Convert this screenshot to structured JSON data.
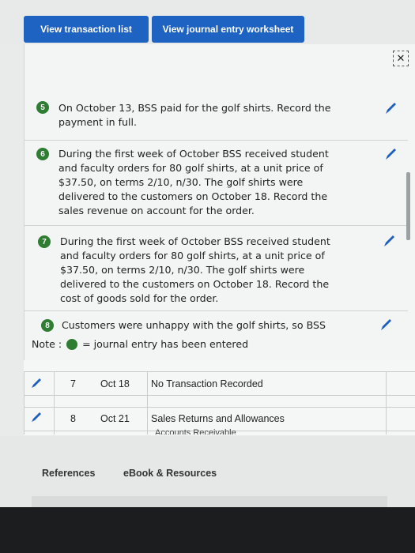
{
  "tabs": {
    "transaction_list": "View transaction list",
    "journal_worksheet": "View journal entry worksheet"
  },
  "close_icon": "✕",
  "items": [
    {
      "num": "5",
      "lines": [
        "On October 13, BSS paid for the golf shirts. Record the",
        "payment in full."
      ]
    },
    {
      "num": "6",
      "lines": [
        "During the first week of October BSS received student",
        "and faculty orders for 80 golf shirts, at a unit price of",
        "$37.50, on terms 2/10, n/30. The golf shirts were",
        "delivered to the customers on October 18. Record the",
        "sales revenue on account for the order."
      ]
    },
    {
      "num": "7",
      "lines": [
        "During the first week of October BSS received student",
        "and faculty orders for 80 golf shirts, at a unit price of",
        "$37.50, on terms 2/10, n/30. The golf shirts were",
        "delivered to the customers on October 18. Record the",
        "cost of goods sold for the order."
      ]
    },
    {
      "num": "8",
      "lines": [
        "Customers were unhappy with the golf shirts, so BSS"
      ]
    }
  ],
  "note": {
    "prefix": "Note :",
    "suffix": "= journal entry has been entered"
  },
  "rows": [
    {
      "num": "7",
      "date": "Oct 18",
      "desc": "No Transaction Recorded"
    },
    {
      "num": "8",
      "date": "Oct 21",
      "desc": "Sales Returns and Allowances",
      "sub": "Accounts Receivable"
    }
  ],
  "links": {
    "references": "References",
    "ebook": "eBook & Resources"
  },
  "colors": {
    "tab_blue": "#1f63c2",
    "badge_green": "#2e7d32",
    "pencil_blue": "#1f5fbf"
  }
}
